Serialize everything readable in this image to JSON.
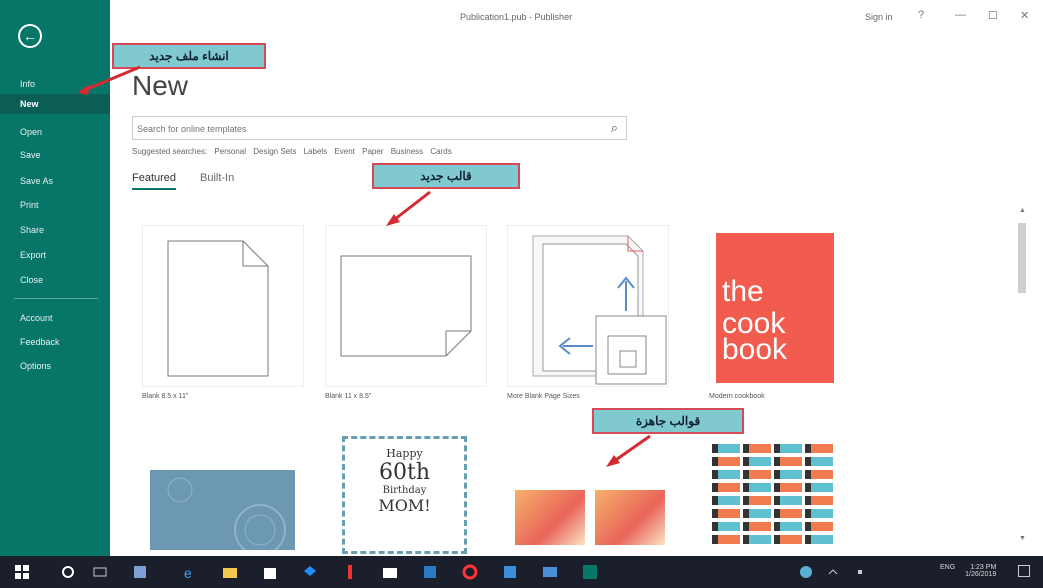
{
  "window": {
    "title": "Publication1.pub - Publisher",
    "signin": "Sign in",
    "help": "?",
    "minimize": "—",
    "maximize": "☐",
    "close": "✕"
  },
  "sidebar": {
    "items": [
      {
        "label": "Info"
      },
      {
        "label": "New"
      },
      {
        "label": "Open"
      },
      {
        "label": "Save"
      },
      {
        "label": "Save As"
      },
      {
        "label": "Print"
      },
      {
        "label": "Share"
      },
      {
        "label": "Export"
      },
      {
        "label": "Close"
      },
      {
        "label": "Account"
      },
      {
        "label": "Feedback"
      },
      {
        "label": "Options"
      }
    ]
  },
  "main": {
    "title": "New",
    "search_placeholder": "Search for online templates",
    "suggested_label": "Suggested searches:",
    "suggested": [
      "Personal",
      "Design Sets",
      "Labels",
      "Event",
      "Paper",
      "Business",
      "Cards"
    ],
    "tabs": [
      "Featured",
      "Built-In"
    ]
  },
  "templates": [
    {
      "caption": "Blank 8.5 x 11\""
    },
    {
      "caption": "Blank 11 x 8.5\""
    },
    {
      "caption": "More Blank Page Sizes"
    },
    {
      "caption": "Modern cookbook"
    }
  ],
  "cookbook_title": [
    "the",
    "cook",
    "book"
  ],
  "birthday_card": [
    "Happy",
    "60th",
    "Birthday",
    "MOM!"
  ],
  "annotations": {
    "create_new": "انشاء ملف جديد",
    "new_template": "قالب جديد",
    "ready_templates": "قوالب جاهزة"
  },
  "tray": {
    "language": "ENG",
    "time": "1:23 PM",
    "date": "1/26/2019"
  },
  "colors": {
    "sidebar": "#077568",
    "annotation_fill": "#7fc9cf",
    "annotation_border": "#d54a55",
    "cookbook": "#f15c4f"
  }
}
